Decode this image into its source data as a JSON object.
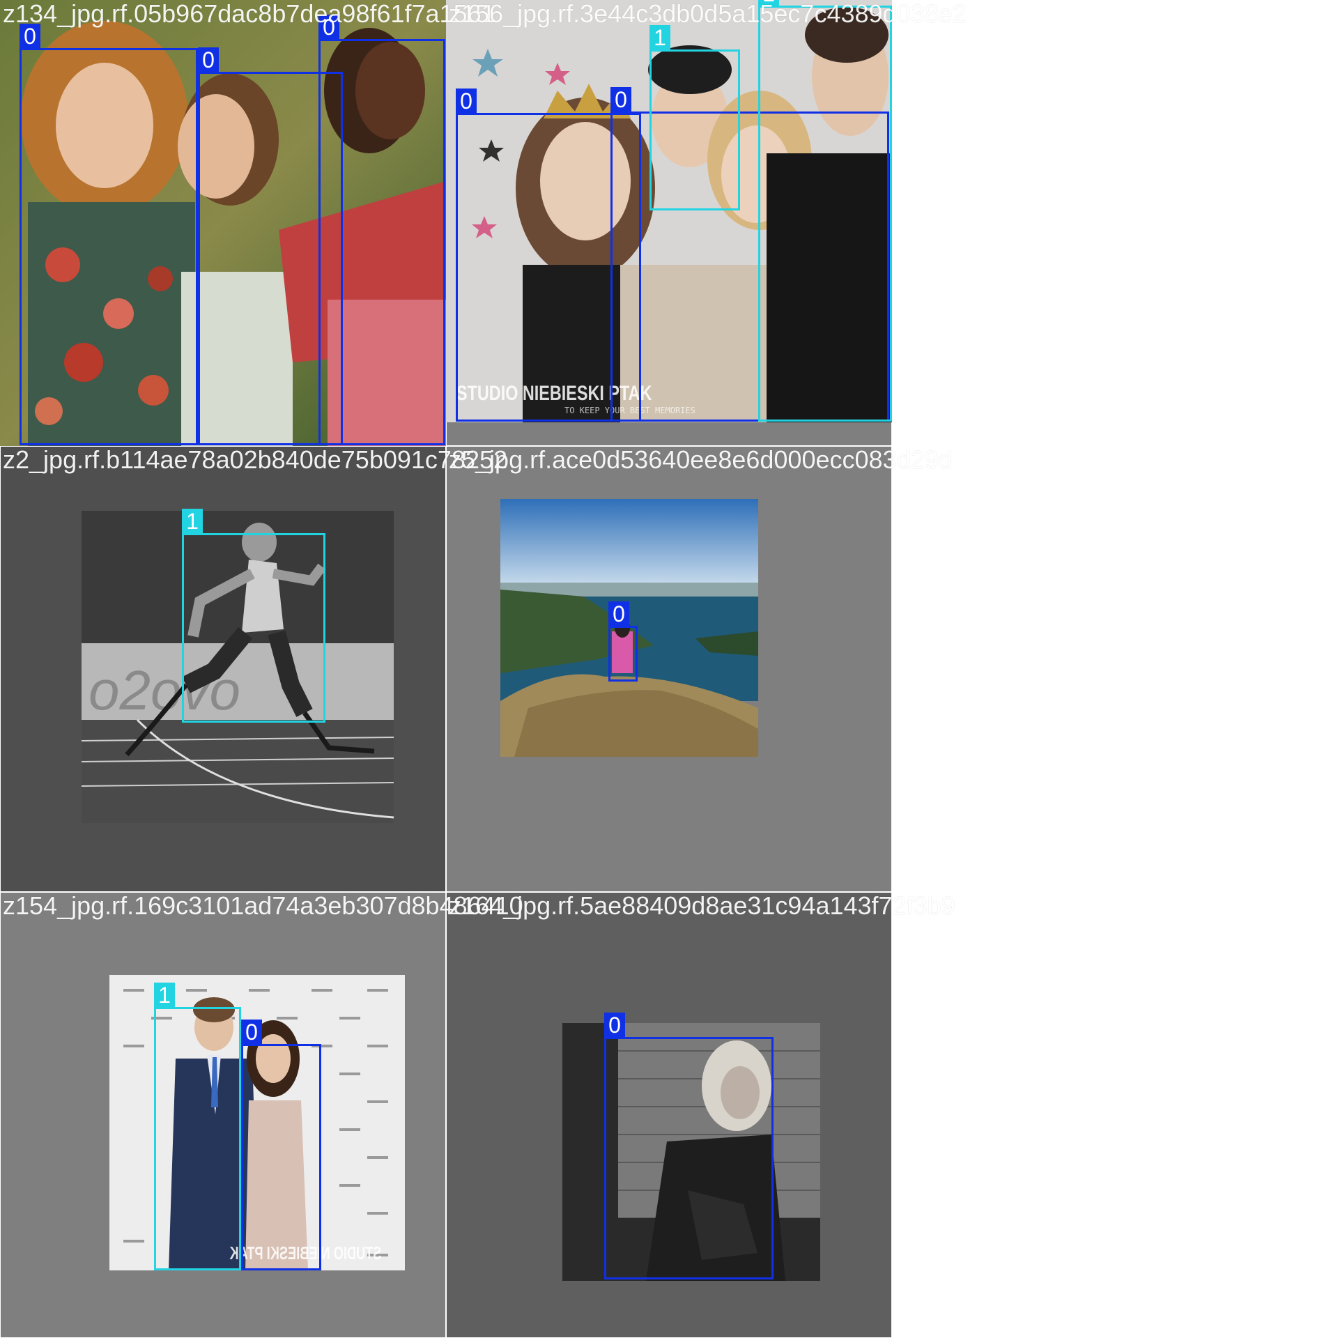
{
  "tiles": [
    {
      "caption": "z134_jpg.rf.05b967dac8b7dea98f61f7a1561",
      "boxes": [
        {
          "class_label": "0"
        },
        {
          "class_label": "0"
        },
        {
          "class_label": "0"
        }
      ]
    },
    {
      "caption": "z156_jpg.rf.3e44c3db0d5a15ec7c4389d038e2",
      "watermark": "STUDIO NIEBIESKI PTAK",
      "watermark_sub": "TO KEEP YOUR BEST MEMORIES",
      "boxes": [
        {
          "class_label": "0"
        },
        {
          "class_label": "0"
        },
        {
          "class_label": "1"
        },
        {
          "class_label": "1"
        }
      ]
    },
    {
      "caption": "z2_jpg.rf.b114ae78a02b840de75b091c78252",
      "boxes": [
        {
          "class_label": "1"
        }
      ]
    },
    {
      "caption": "z5_jpg.rf.ace0d53640ee8e6d000ecc083d29d",
      "boxes": [
        {
          "class_label": "0"
        }
      ]
    },
    {
      "caption": "z154_jpg.rf.169c3101ad74a3eb307d8b486410",
      "watermark": "STUDIO NIEBIESKI PTAK",
      "boxes": [
        {
          "class_label": "1"
        },
        {
          "class_label": "0"
        }
      ]
    },
    {
      "caption": "z164_jpg.rf.5ae88409d8ae31c94a143f72f3b9",
      "boxes": [
        {
          "class_label": "0"
        }
      ]
    }
  ],
  "colors": {
    "class_0": "#1030e6",
    "class_1": "#22d3e2",
    "tile_bg_dark": "#4f4f4f",
    "tile_bg_mid": "#7f7f7f"
  }
}
